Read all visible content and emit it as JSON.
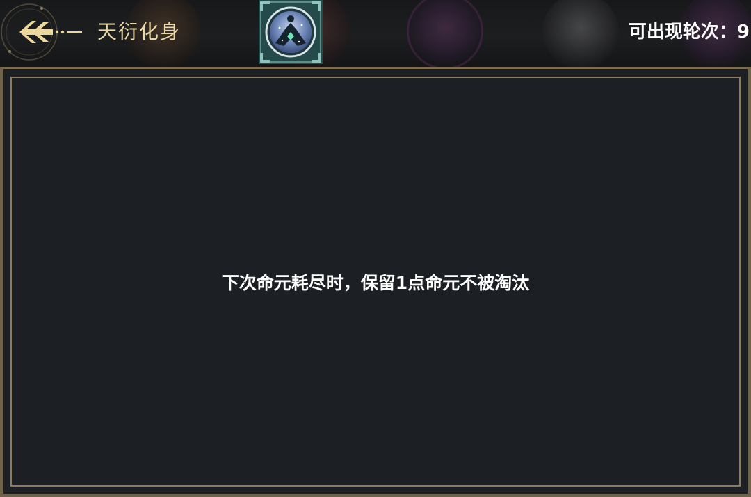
{
  "header": {
    "title": "天衍化身",
    "rounds_label": "可出现轮次：9"
  },
  "panel": {
    "description": "下次命元耗尽时，保留1点命元不被淘汰"
  },
  "colors": {
    "accent_gold": "#e9d7a6",
    "panel_bg": "#1c2024",
    "frame": "#8d7c5c"
  },
  "icons": {
    "back": "back-arrow-icon",
    "emblem": "avatar-emblem-icon"
  }
}
